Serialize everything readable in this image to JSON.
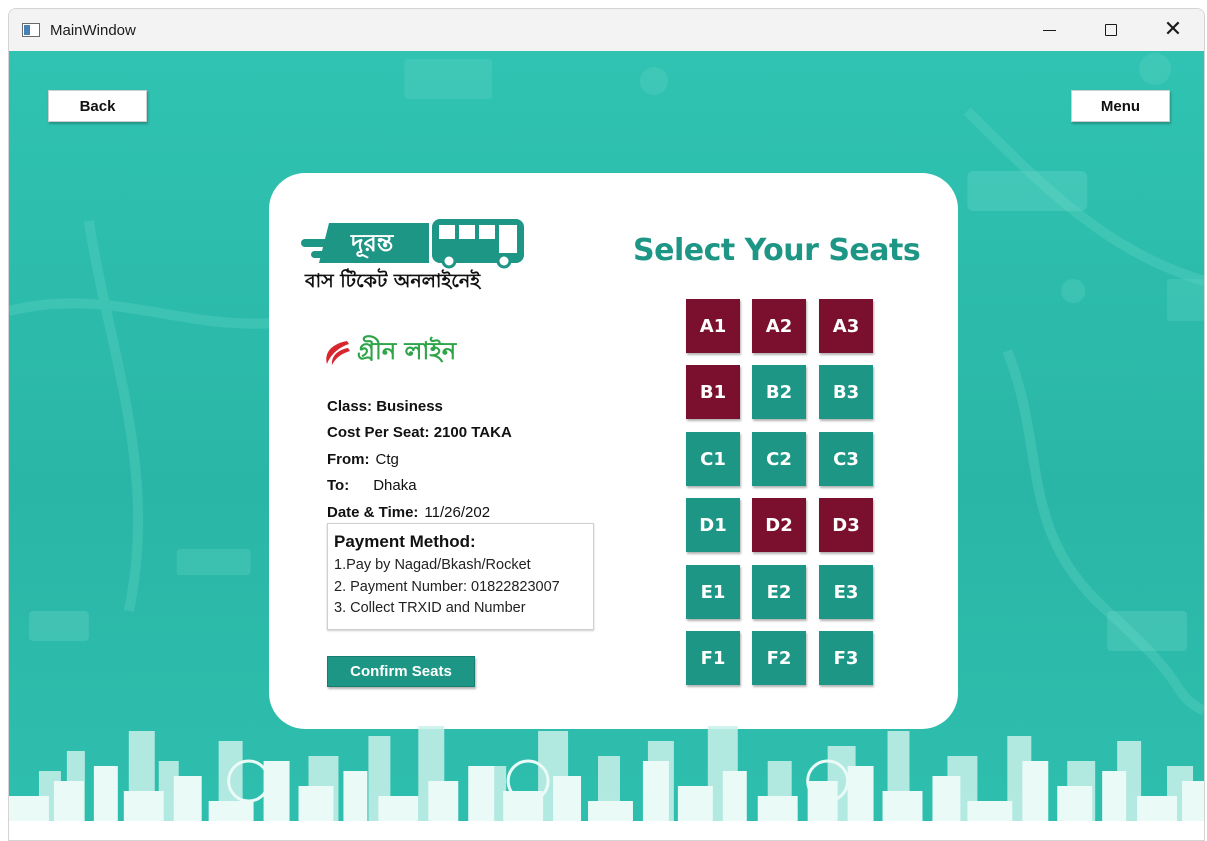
{
  "window": {
    "title": "MainWindow",
    "controls": {
      "minimize": "minimize-icon",
      "maximize": "maximize-icon",
      "close": "close-icon"
    }
  },
  "nav": {
    "back_label": "Back",
    "menu_label": "Menu"
  },
  "brand": {
    "logo_text": "দূরন্ত",
    "tagline": "বাস টিকেট অনলাইনেই",
    "operator_name": "গ্রীন লাইন"
  },
  "trip": {
    "class_label": "Class: Business",
    "cost_label": "Cost Per Seat: 2100 TAKA",
    "from_label": "From:",
    "from_value": "Ctg",
    "to_label": "To:",
    "to_value": "Dhaka",
    "datetime_label": "Date & Time:",
    "datetime_value": "11/26/202"
  },
  "payment": {
    "title": "Payment Method:",
    "line1": "1.Pay by Nagad/Bkash/Rocket",
    "line2": "2. Payment Number: 01822823007",
    "line3": "3. Collect TRXID and Number"
  },
  "confirm_label": "Confirm Seats",
  "seats": {
    "title": "Select Your Seats",
    "colors": {
      "available": "#1e9685",
      "booked": "#7b0f2e"
    },
    "rows": [
      [
        {
          "id": "A1",
          "status": "booked"
        },
        {
          "id": "A2",
          "status": "booked"
        },
        {
          "id": "A3",
          "status": "booked"
        }
      ],
      [
        {
          "id": "B1",
          "status": "booked"
        },
        {
          "id": "B2",
          "status": "available"
        },
        {
          "id": "B3",
          "status": "available"
        }
      ],
      [
        {
          "id": "C1",
          "status": "available"
        },
        {
          "id": "C2",
          "status": "available"
        },
        {
          "id": "C3",
          "status": "available"
        }
      ],
      [
        {
          "id": "D1",
          "status": "available"
        },
        {
          "id": "D2",
          "status": "booked"
        },
        {
          "id": "D3",
          "status": "booked"
        }
      ],
      [
        {
          "id": "E1",
          "status": "available"
        },
        {
          "id": "E2",
          "status": "available"
        },
        {
          "id": "E3",
          "status": "available"
        }
      ],
      [
        {
          "id": "F1",
          "status": "available"
        },
        {
          "id": "F2",
          "status": "available"
        },
        {
          "id": "F3",
          "status": "available"
        }
      ]
    ]
  }
}
